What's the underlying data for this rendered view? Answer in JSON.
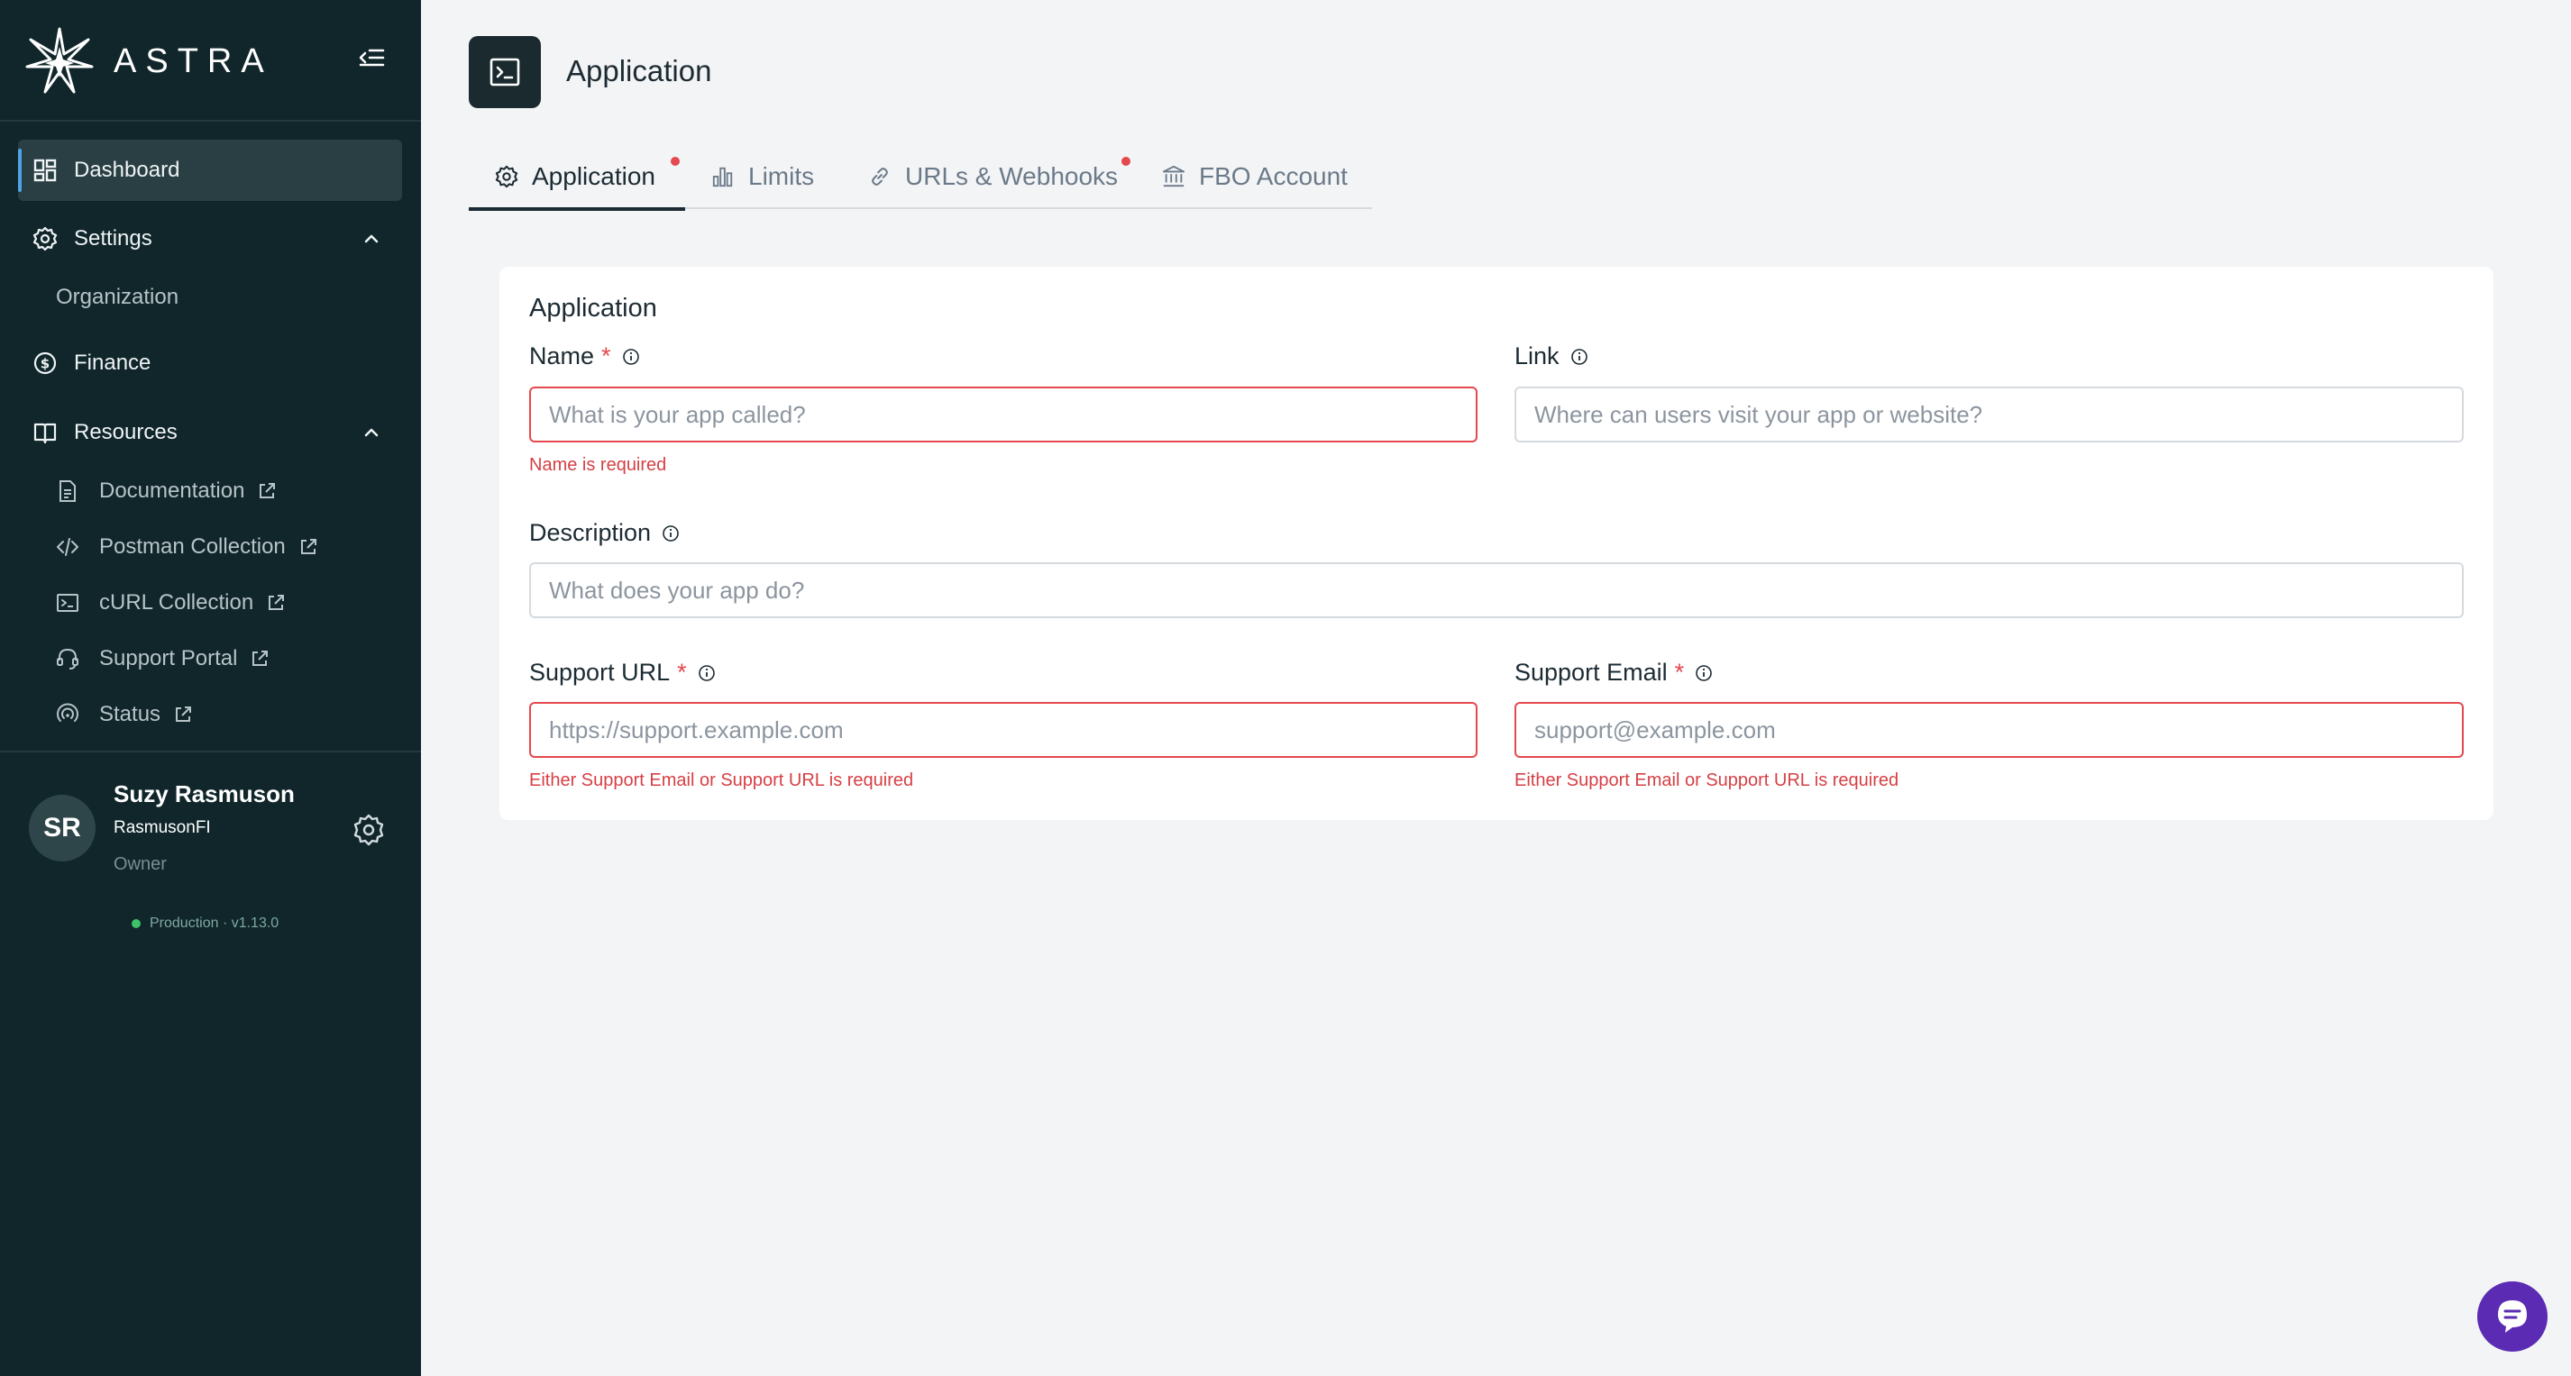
{
  "brand": {
    "name": "ASTRA"
  },
  "nav": {
    "dashboard": "Dashboard",
    "settings": "Settings",
    "settings_children": [
      "Organization"
    ],
    "finance": "Finance",
    "resources": "Resources",
    "resources_children": [
      {
        "label": "Documentation",
        "icon": "document-icon"
      },
      {
        "label": "Postman Collection",
        "icon": "code-icon"
      },
      {
        "label": "cURL Collection",
        "icon": "terminal-icon"
      },
      {
        "label": "Support Portal",
        "icon": "headset-icon"
      },
      {
        "label": "Status",
        "icon": "signal-icon"
      }
    ]
  },
  "profile": {
    "initials": "SR",
    "name": "Suzy Rasmuson",
    "org": "RasmusonFI",
    "role": "Owner"
  },
  "environment": "Production · v1.13.0",
  "page": {
    "title": "Application"
  },
  "tabs": [
    {
      "label": "Application",
      "icon": "gear-icon",
      "active": true,
      "alert": true
    },
    {
      "label": "Limits",
      "icon": "bar-chart-icon",
      "active": false,
      "alert": false
    },
    {
      "label": "URLs & Webhooks",
      "icon": "link-icon",
      "active": false,
      "alert": true
    },
    {
      "label": "FBO Account",
      "icon": "bank-icon",
      "active": false,
      "alert": false
    }
  ],
  "form": {
    "title": "Application",
    "name": {
      "label": "Name",
      "required_mark": "*",
      "placeholder": "What is your app called?",
      "error": "Name is required"
    },
    "link": {
      "label": "Link",
      "placeholder": "Where can users visit your app or website?"
    },
    "description": {
      "label": "Description",
      "placeholder": "What does your app do?"
    },
    "support_url": {
      "label": "Support URL",
      "required_mark": "*",
      "placeholder": "https://support.example.com",
      "error": "Either Support Email or Support URL is required"
    },
    "support_email": {
      "label": "Support Email",
      "required_mark": "*",
      "placeholder": "support@example.com",
      "error": "Either Support Email or Support URL is required"
    }
  },
  "colors": {
    "sidebar_bg": "#10262b",
    "error": "#e5484d",
    "chat_bubble": "#5b2bb3",
    "active_indicator": "#4fa4e8"
  }
}
